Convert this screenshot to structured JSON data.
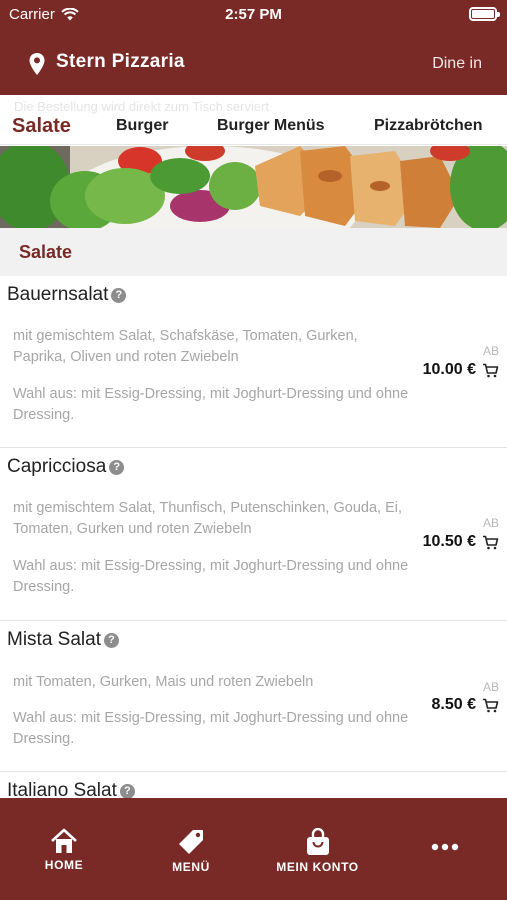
{
  "status_bar": {
    "carrier": "Carrier",
    "time": "2:57 PM"
  },
  "header": {
    "restaurant_name": "Stern Pizzaria",
    "mode": "Dine in",
    "ghost_notice": "Die Bestellung wird direkt zum Tisch serviert"
  },
  "tabs": [
    {
      "label": "Salate",
      "active": true
    },
    {
      "label": "Burger",
      "active": false
    },
    {
      "label": "Burger Menüs",
      "active": false
    },
    {
      "label": "Pizzabrötchen",
      "active": false
    }
  ],
  "section": {
    "title": "Salate"
  },
  "items": [
    {
      "name": "Bauernsalat",
      "desc": "mit gemischtem Salat, Schafskäse, Tomaten, Gurken, Paprika, Oliven und roten Zwiebeln",
      "options": "Wahl aus: mit Essig-Dressing, mit Joghurt-Dressing und ohne Dressing.",
      "ab": "AB",
      "price": "10.00 €"
    },
    {
      "name": "Capricciosa",
      "desc": "mit gemischtem Salat, Thunfisch, Putenschinken, Gouda, Ei, Tomaten, Gurken und roten Zwiebeln",
      "options": "Wahl aus: mit Essig-Dressing, mit Joghurt-Dressing und ohne Dressing.",
      "ab": "AB",
      "price": "10.50 €"
    },
    {
      "name": "Mista Salat",
      "desc": "mit Tomaten, Gurken, Mais und roten Zwiebeln",
      "options": "Wahl aus: mit Essig-Dressing, mit Joghurt-Dressing und ohne Dressing.",
      "ab": "AB",
      "price": "8.50 €"
    },
    {
      "name": "Italiano Salat"
    }
  ],
  "bottom_nav": [
    {
      "label": "HOME",
      "icon": "home-icon"
    },
    {
      "label": "MENÜ",
      "icon": "tag-icon"
    },
    {
      "label": "MEIN KONTO",
      "icon": "bag-icon"
    },
    {
      "label": "",
      "icon": "more-icon"
    }
  ],
  "colors": {
    "brand": "#7a2a26",
    "section_bg": "#f1f1f1",
    "muted_text": "#a6a6a6"
  }
}
